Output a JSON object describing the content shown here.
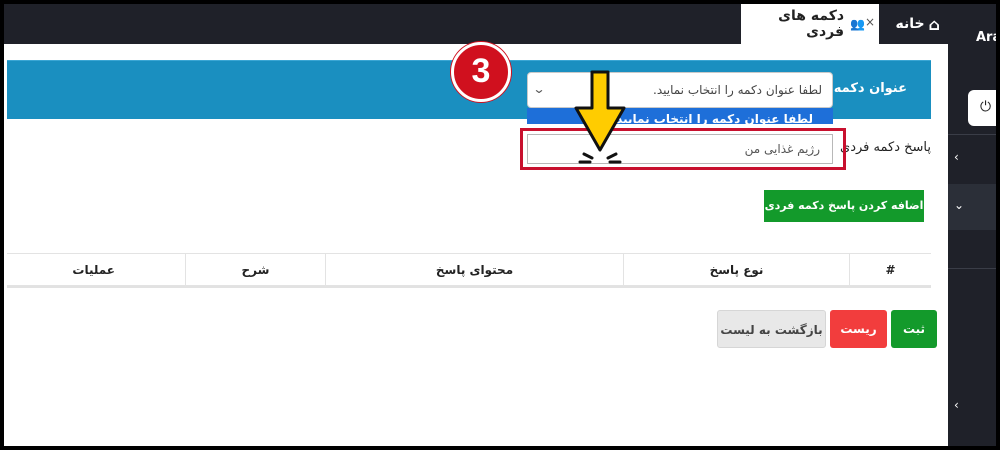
{
  "tabs": {
    "home_label": "خانه",
    "active_label": "دکمه های فردی",
    "close_glyph": "×"
  },
  "sidebar": {
    "brand_text": "Ara",
    "power_icon": "power-icon",
    "items": [
      {
        "icon": "chevron-left-icon",
        "glyph": "‹"
      },
      {
        "icon": "chevron-down-icon",
        "glyph": "⌄"
      },
      {
        "icon": "chevron-left-icon",
        "glyph": "‹"
      }
    ]
  },
  "form": {
    "title_label": "عنوان دکمه",
    "select_placeholder": "لطفا عنوان دکمه را انتخاب نمایید.",
    "dropdown_highlighted_option": "لطفا عنوان دکمه را انتخاب نمایید.",
    "response_label": "پاسخ دکمه فردی",
    "response_value": "رژیم غذایی من",
    "add_response_button": "اضافه کردن پاسخ دکمه فردی"
  },
  "table": {
    "headers": [
      "#",
      "نوع پاسخ",
      "محتوای پاسخ",
      "شرح",
      "عملیات"
    ],
    "rows": []
  },
  "actions": {
    "submit_label": "ثبت",
    "reset_label": "ریست",
    "back_label": "بازگشت به لیست"
  },
  "annotation": {
    "step_number": "3"
  },
  "colors": {
    "header_blue": "#1a8fc0",
    "dropdown_highlight": "#1e6fd9",
    "success_green": "#139a2b",
    "danger_red": "#f23d3d",
    "callout_red": "#c8102e",
    "arrow_yellow": "#ffcc00",
    "dark_chrome": "#1f2129"
  }
}
